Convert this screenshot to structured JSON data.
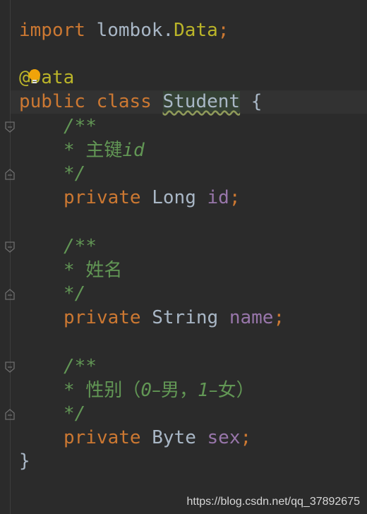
{
  "code": {
    "import_kw": "import",
    "import_pkg": "lombok.",
    "import_cls": "Data",
    "import_end": ";",
    "annotation": "@Data",
    "class_mods": "public class",
    "class_name": "Student",
    "class_brace": "{",
    "close_brace": "}",
    "doc_open": "/**",
    "doc_close": "*/",
    "fields": [
      {
        "comment_star": "* ",
        "comment_cjk": "主键",
        "comment_rest": "id",
        "modifier": "private",
        "type": "Long",
        "name": "id",
        "end": ";"
      },
      {
        "comment_star": "* ",
        "comment_cjk": "姓名",
        "comment_rest": "",
        "modifier": "private",
        "type": "String",
        "name": "name",
        "end": ";"
      },
      {
        "comment_star": "* ",
        "comment_cjk": "性别（",
        "comment_rest": "0",
        "comment_cjk2": "–男，",
        "comment_rest2": "1",
        "comment_cjk3": "–女）",
        "modifier": "private",
        "type": "Byte",
        "name": "sex",
        "end": ";"
      }
    ]
  },
  "icons": {
    "bulb": "intention-bulb-icon",
    "fold_open": "fold-open-icon",
    "fold_close": "fold-close-icon"
  },
  "colors": {
    "background": "#2b2b2b",
    "keyword": "#cc7832",
    "text": "#a9b7c6",
    "annotation": "#bbb529",
    "field": "#9876aa",
    "comment": "#629755"
  },
  "watermark": "https://blog.csdn.net/qq_37892675"
}
